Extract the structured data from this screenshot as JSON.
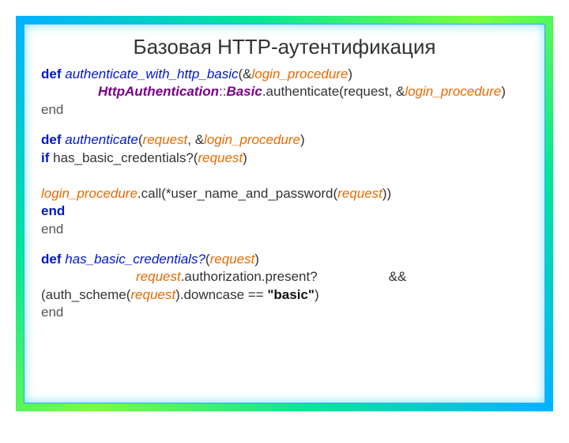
{
  "title": "Базовая HTTP-аутентификация",
  "b1": {
    "def": "def",
    "fn": "authenticate_with_http_basic",
    "p1": "(&",
    "arg1": "login_procedure",
    "p2": ")",
    "cls": "HttpAuthentication",
    "scope": "::",
    "cls2": "Basic",
    "call": ".authenticate(request, &",
    "arg2": "login_procedure",
    "p3": ")",
    "end": "end"
  },
  "b2": {
    "def": "def",
    "fn": "authenticate",
    "p1": "(",
    "arg1": "request",
    "c1": ", &",
    "arg2": "login_procedure",
    "p2": ")",
    "if": "if",
    "call1": " has_basic_credentials?(",
    "arg3": "request",
    "p3": ")",
    "lp": "login_procedure",
    "call2": ".call(*user_name_and_password(",
    "arg4": "request",
    "p4": "))",
    "endif": "end",
    "end": "end"
  },
  "b3": {
    "def": "def",
    "fn": "has_basic_credentials?",
    "p1": "(",
    "arg1": "request",
    "p2": ")",
    "arg2": "request",
    "t1": ".authorization.present?",
    "amp": "&& (auth_scheme(",
    "arg3": "request",
    "t2": ").downcase == ",
    "str": "\"basic\"",
    "p3": ")",
    "end": "end"
  }
}
